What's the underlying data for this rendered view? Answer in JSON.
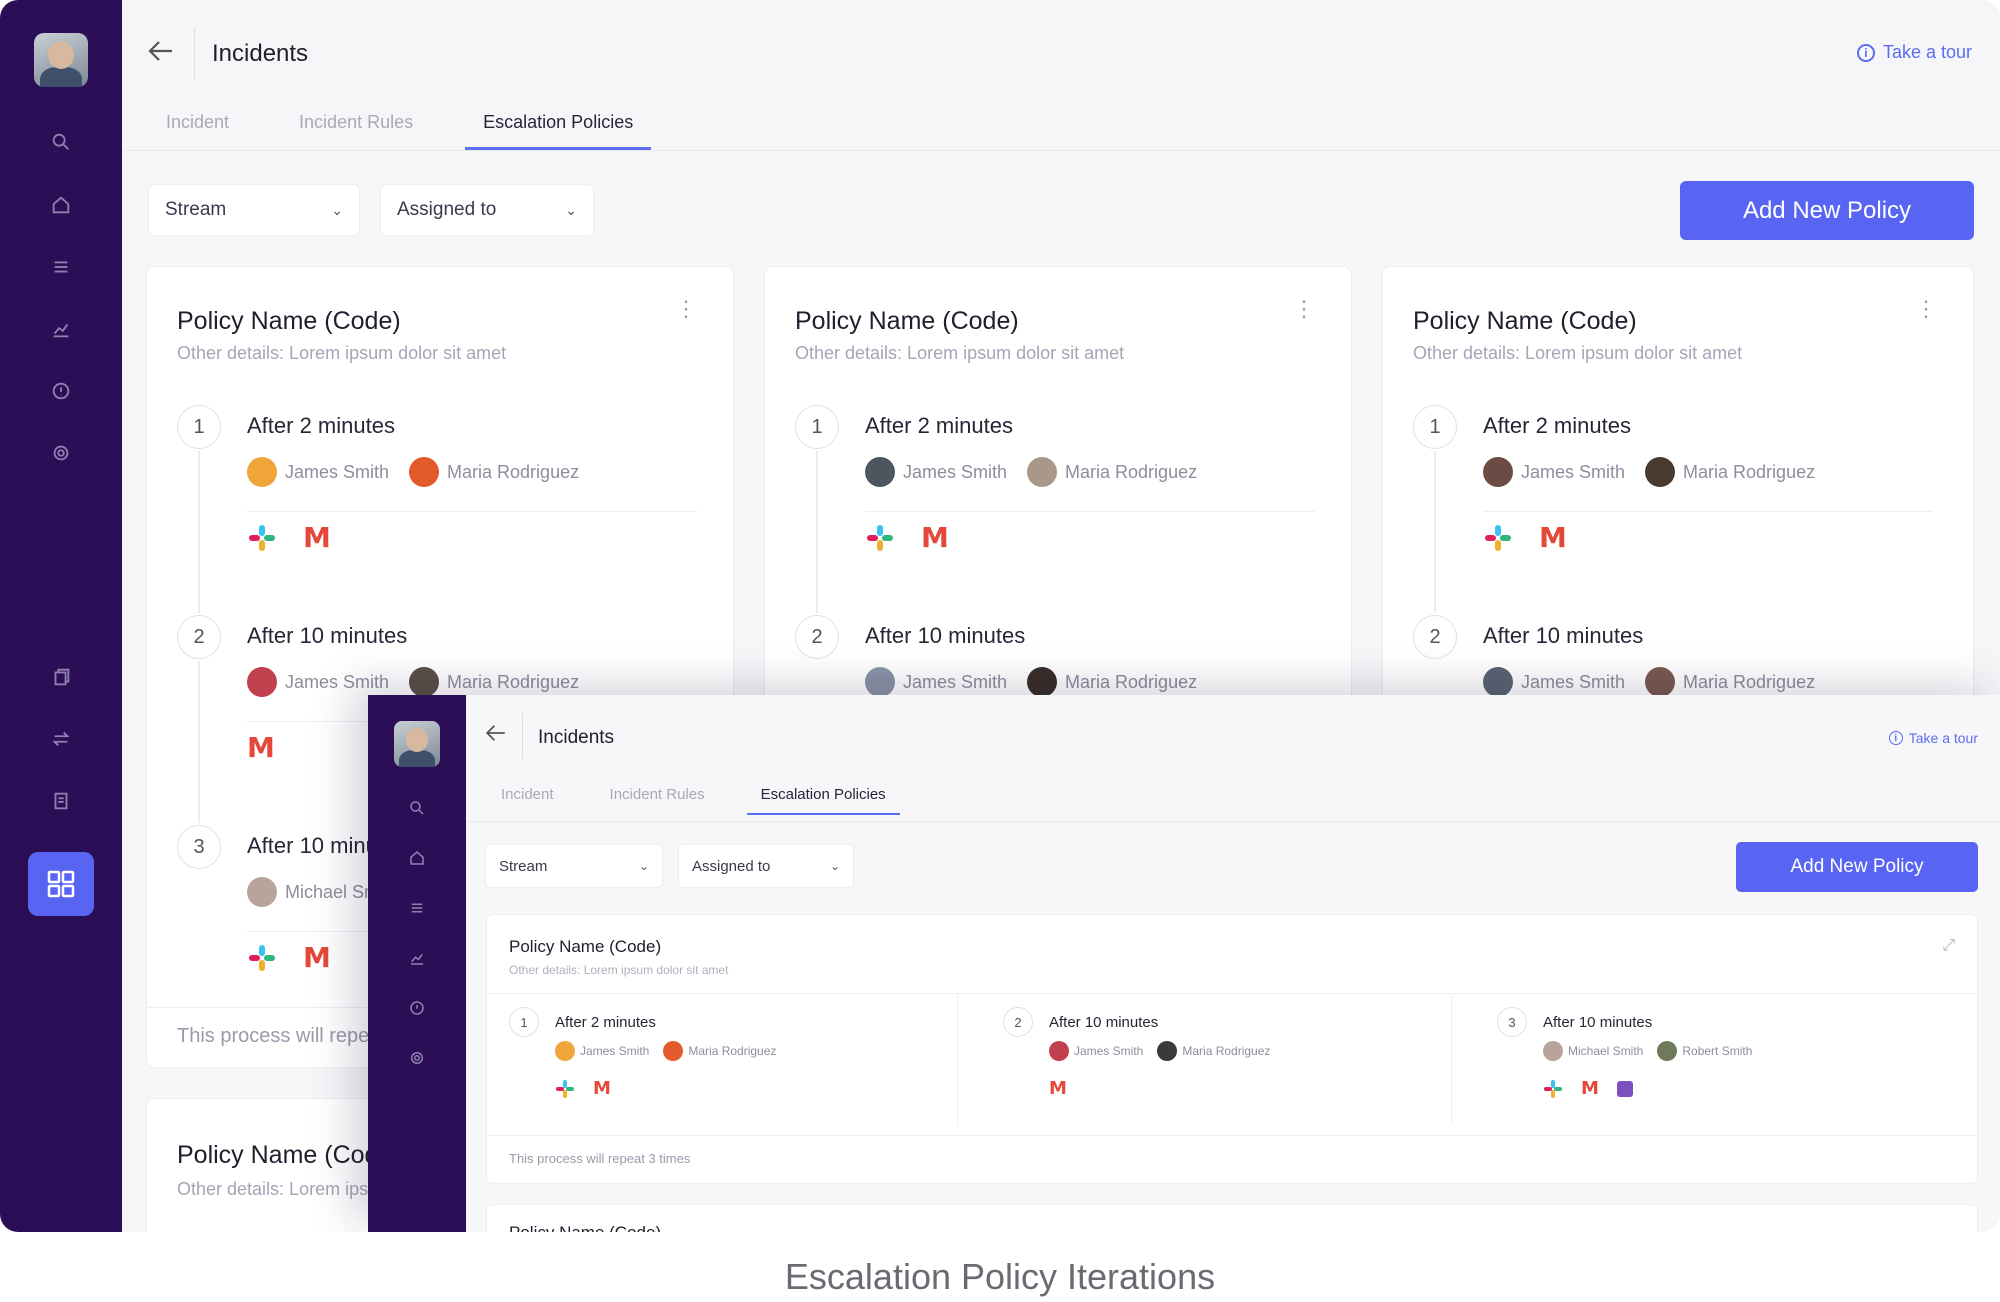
{
  "main": {
    "title": "Incidents",
    "take_tour": "Take a tour",
    "tabs": [
      {
        "label": "Incident"
      },
      {
        "label": "Incident Rules"
      },
      {
        "label": "Escalation Policies"
      }
    ],
    "active_tab": "Escalation Policies",
    "filters": {
      "stream": "Stream",
      "assigned": "Assigned to"
    },
    "add_button": "Add New Policy",
    "cards": [
      {
        "title": "Policy Name (Code)",
        "subtitle": "Other details: Lorem ipsum dolor sit amet",
        "steps": [
          {
            "num": "1",
            "label": "After 2 minutes",
            "p1": "James Smith",
            "p2": "Maria Rodriguez"
          },
          {
            "num": "2",
            "label": "After 10 minutes",
            "p1": "James Smith",
            "p2": "Maria Rodriguez"
          },
          {
            "num": "3",
            "label": "After 10 minutes",
            "p1": "Michael Smith"
          }
        ],
        "footer": "This process will repeat 3 times"
      },
      {
        "title": "Policy Name (Code)",
        "subtitle": "Other details: Lorem ipsum dolor sit amet",
        "steps": [
          {
            "num": "1",
            "label": "After 2 minutes",
            "p1": "James Smith",
            "p2": "Maria Rodriguez"
          },
          {
            "num": "2",
            "label": "After 10 minutes",
            "p1": "James Smith",
            "p2": "Maria Rodriguez"
          }
        ]
      },
      {
        "title": "Policy Name (Code)",
        "subtitle": "Other details: Lorem ipsum dolor sit amet",
        "steps": [
          {
            "num": "1",
            "label": "After 2 minutes",
            "p1": "James Smith",
            "p2": "Maria Rodriguez"
          },
          {
            "num": "2",
            "label": "After 10 minutes",
            "p1": "James Smith",
            "p2": "Maria Rodriguez"
          }
        ]
      },
      {
        "title": "Policy Name (Code)",
        "subtitle": "Other details: Lorem ipsum dolor sit amet"
      }
    ]
  },
  "overlay": {
    "title": "Incidents",
    "take_tour": "Take a tour",
    "tabs": [
      {
        "label": "Incident"
      },
      {
        "label": "Incident Rules"
      },
      {
        "label": "Escalation Policies"
      }
    ],
    "filters": {
      "stream": "Stream",
      "assigned": "Assigned to"
    },
    "add_button": "Add New Policy",
    "card": {
      "title": "Policy Name (Code)",
      "subtitle": "Other details: Lorem ipsum dolor sit amet",
      "steps": [
        {
          "num": "1",
          "label": "After 2 minutes",
          "p1": "James Smith",
          "p2": "Maria Rodriguez"
        },
        {
          "num": "2",
          "label": "After 10 minutes",
          "p1": "James Smith",
          "p2": "Maria Rodriguez"
        },
        {
          "num": "3",
          "label": "After 10 minutes",
          "p1": "Michael Smith",
          "p2": "Robert Smith"
        }
      ],
      "footer": "This process will repeat 3 times"
    },
    "card2_title": "Policy Name (Code)"
  },
  "caption": "Escalation Policy Iterations",
  "colors": {
    "sidebar": "#2b0e55",
    "accent": "#5765f2",
    "gmail": "#e4483b"
  },
  "icons": [
    "search-icon",
    "home-icon",
    "list-icon",
    "chart-icon",
    "info-icon",
    "gear-icon",
    "copy-icon",
    "swap-icon",
    "document-icon",
    "grid-icon",
    "back-arrow-icon",
    "slack-icon",
    "gmail-icon",
    "viber-icon",
    "kebab-icon",
    "expand-icon"
  ]
}
